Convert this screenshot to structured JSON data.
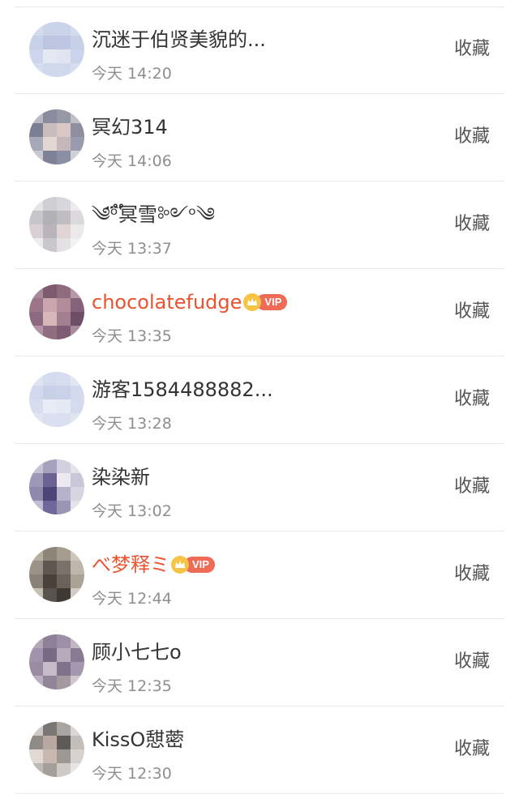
{
  "colors": {
    "name_normal": "#333333",
    "name_vip": "#e9532f",
    "time": "#8e8e8e",
    "action": "#555555",
    "divider": "#e9e9e9",
    "vip_badge": "#ee6b55",
    "crown": "#f6c343"
  },
  "rows": [
    {
      "name": "沉迷于伯贤美貌的...",
      "time": "今天 14:20",
      "action": "收藏",
      "vip": false,
      "avatar": [
        "#d3dbee",
        "#c9d3ea",
        "#c9d3ea",
        "#d3dbee",
        "#c7d1e8",
        "#bcc6e0",
        "#bdc7e1",
        "#c6d0e7",
        "#cdd6ec",
        "#e4e8f3",
        "#dfe4f0",
        "#cbd4ea",
        "#d6ddef",
        "#d0d8ec",
        "#d0d8ec",
        "#d6ddef"
      ]
    },
    {
      "name": "冥幻314",
      "time": "今天 14:06",
      "action": "收藏",
      "vip": false,
      "avatar": [
        "#b9b9c4",
        "#8a8c9d",
        "#9799a7",
        "#c0bfc6",
        "#7b7f95",
        "#c9bcbd",
        "#d9c7c5",
        "#8e8e9e",
        "#a6a9b8",
        "#e4d6d2",
        "#c4b8bb",
        "#9a9cae",
        "#c8c9d2",
        "#7f8297",
        "#8c8fa3",
        "#cfd0d8"
      ]
    },
    {
      "name": "༄ᵒ፝֟冥雪༻ᵒ༄",
      "time": "今天 13:37",
      "action": "收藏",
      "vip": false,
      "avatar": [
        "#e4e4e6",
        "#cfcfd3",
        "#d7d6da",
        "#eceaeb",
        "#c6c5ca",
        "#b2b1b8",
        "#bfbcc2",
        "#dcd9dc",
        "#d8d0d2",
        "#b9b4b9",
        "#e0d4d4",
        "#ece9ea",
        "#ececee",
        "#c9c7cc",
        "#e3e1e4",
        "#f3f2f3"
      ]
    },
    {
      "name": "chocolatefudge",
      "time": "今天 13:35",
      "action": "收藏",
      "vip": true,
      "avatar": [
        "#a8899a",
        "#7d5a6e",
        "#8f6b7e",
        "#b799a8",
        "#9c7688",
        "#c9a6ae",
        "#b28c99",
        "#86627a",
        "#8e6a82",
        "#d8b7bb",
        "#a47f90",
        "#6e4d66",
        "#b294a6",
        "#916d82",
        "#7f5c73",
        "#a98b9d"
      ]
    },
    {
      "name": "游客1584488882...",
      "time": "今天 13:28",
      "action": "收藏",
      "vip": false,
      "avatar": [
        "#dfe4f2",
        "#d5dbee",
        "#d7ddef",
        "#e1e6f3",
        "#d2d9ed",
        "#c8d0e8",
        "#cad2e9",
        "#d3daed",
        "#d7ddef",
        "#e8ecf6",
        "#e5e9f4",
        "#d5dbee",
        "#e0e5f2",
        "#dae0f0",
        "#dae0f0",
        "#e1e6f3"
      ]
    },
    {
      "name": "染染新",
      "time": "今天 13:02",
      "action": "收藏",
      "vip": false,
      "avatar": [
        "#c4c2d4",
        "#a6a2bd",
        "#d2d0de",
        "#e4e3ec",
        "#9d98b7",
        "#6c6392",
        "#ece8f0",
        "#c9c6d8",
        "#8f89ad",
        "#4e4478",
        "#b7b2cb",
        "#d8d5e3",
        "#c1bdd2",
        "#6f679a",
        "#9b95b5",
        "#e5e3ec"
      ]
    },
    {
      "name": "べ梦释ミ",
      "time": "今天 12:44",
      "action": "收藏",
      "vip": true,
      "avatar": [
        "#b7ae9f",
        "#8e8579",
        "#a69d90",
        "#cdc6bb",
        "#9b9287",
        "#5f574f",
        "#7a7168",
        "#bdb6ab",
        "#8a8279",
        "#48413c",
        "#6b635b",
        "#aaa296",
        "#c6bfb4",
        "#5a534d",
        "#3f3935",
        "#d2ccc2"
      ]
    },
    {
      "name": "顾小七七o",
      "time": "今天 12:35",
      "action": "收藏",
      "vip": false,
      "avatar": [
        "#b4a8b7",
        "#8e8098",
        "#9d90a6",
        "#c1b6c4",
        "#a193ab",
        "#766a84",
        "#b8aabd",
        "#8a7b95",
        "#9a8ba3",
        "#c7bac9",
        "#7f7289",
        "#a597ad",
        "#bcb0c0",
        "#928599",
        "#a5999f",
        "#cfc6d0"
      ]
    },
    {
      "name": "KissO憇蔤",
      "time": "今天 12:30",
      "action": "收藏",
      "vip": false,
      "avatar": [
        "#cdc9c6",
        "#7a7674",
        "#a8a4a1",
        "#d9d6d4",
        "#8f8b88",
        "#b7a8a2",
        "#5e5a58",
        "#c2beba",
        "#e2d9d4",
        "#c8b8b0",
        "#9d9894",
        "#d6d2cf",
        "#bfb9b5",
        "#a49f9b",
        "#cfcac6",
        "#e8e5e3"
      ]
    }
  ]
}
